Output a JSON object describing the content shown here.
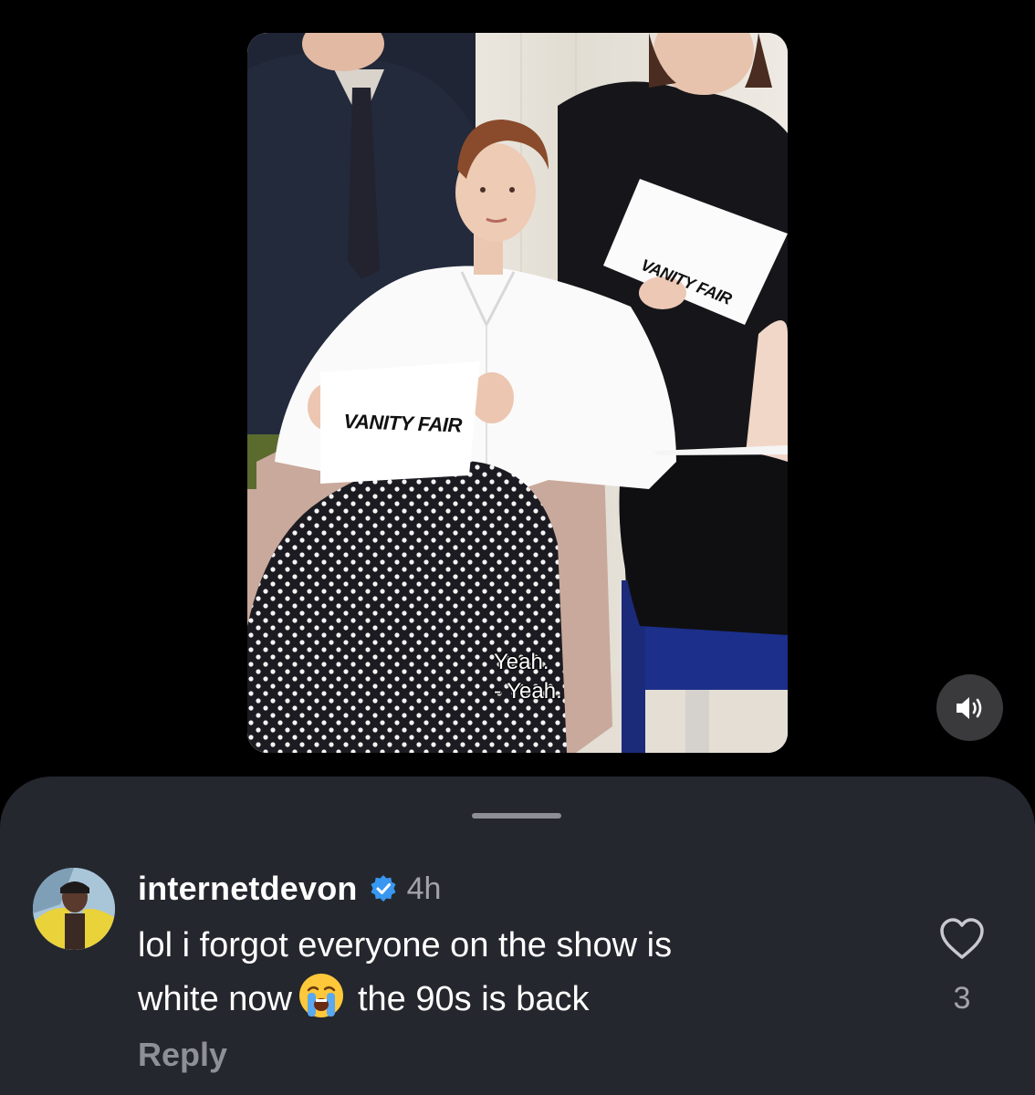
{
  "video": {
    "caption_lines": [
      "Yeah.",
      "- Yeah."
    ],
    "sign_text": "VANITY FAIR",
    "sound_icon": "speaker-on-icon"
  },
  "comment": {
    "username": "internetdevon",
    "verified_icon": "verified-badge-icon",
    "time": "4h",
    "text_line1": "lol i forgot everyone on the show is",
    "text_line2_before_emoji": "white now",
    "emoji_icon": "loudly-crying-face-emoji",
    "text_line2_after_emoji": "the 90s is back",
    "reply_label": "Reply",
    "like_icon": "heart-outline-icon",
    "like_count": "3"
  },
  "colors": {
    "background": "#000000",
    "sheet": "#25272e",
    "verified_blue": "#3897f0",
    "muted_text": "#8e9097"
  }
}
